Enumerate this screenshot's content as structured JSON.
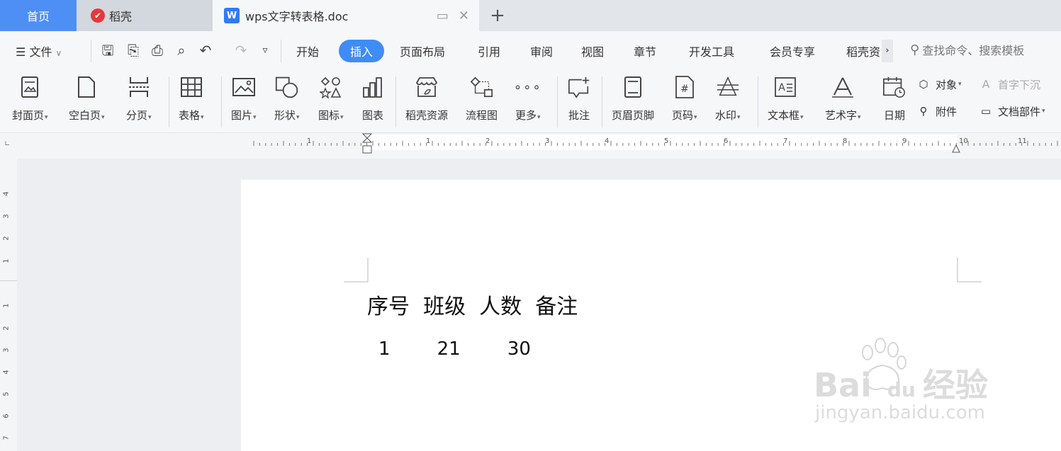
{
  "tabs": {
    "home": "首页",
    "daoke": "稻壳",
    "document": "wps文字转表格.doc",
    "new_tab": "+"
  },
  "menu": {
    "file": "文件",
    "items": [
      "开始",
      "插入",
      "页面布局",
      "引用",
      "审阅",
      "视图",
      "章节",
      "开发工具",
      "会员专享",
      "稻壳资"
    ],
    "active": "插入",
    "search_placeholder": "查找命令、搜索模板"
  },
  "ribbon": {
    "cover_page": "封面页",
    "blank_page": "空白页",
    "page_break": "分页",
    "table": "表格",
    "picture": "图片",
    "shape": "形状",
    "icon": "图标",
    "chart": "图表",
    "daoke_resources": "稻壳资源",
    "flowchart": "流程图",
    "more": "更多",
    "comment": "批注",
    "header_footer": "页眉页脚",
    "page_number": "页码",
    "watermark": "水印",
    "textbox": "文本框",
    "wordart": "艺术字",
    "date": "日期",
    "object": "对象",
    "attachment": "附件",
    "drop_cap": "首字下沉",
    "doc_parts": "文档部件"
  },
  "ruler": {
    "h_numbers": [
      "1",
      "1",
      "2",
      "3",
      "4",
      "5",
      "6",
      "7",
      "8",
      "9",
      "10",
      "11"
    ],
    "v_numbers": [
      "4",
      "3",
      "2",
      "1",
      "1",
      "2",
      "3",
      "4",
      "5",
      "6",
      "7"
    ]
  },
  "document": {
    "header_line": "序号  班级  人数  备注",
    "data_line": "1        21        30"
  },
  "watermark": {
    "brand": "Bai",
    "brand2": "du",
    "brand3": "经验",
    "url": "jingyan.baidu.com"
  }
}
